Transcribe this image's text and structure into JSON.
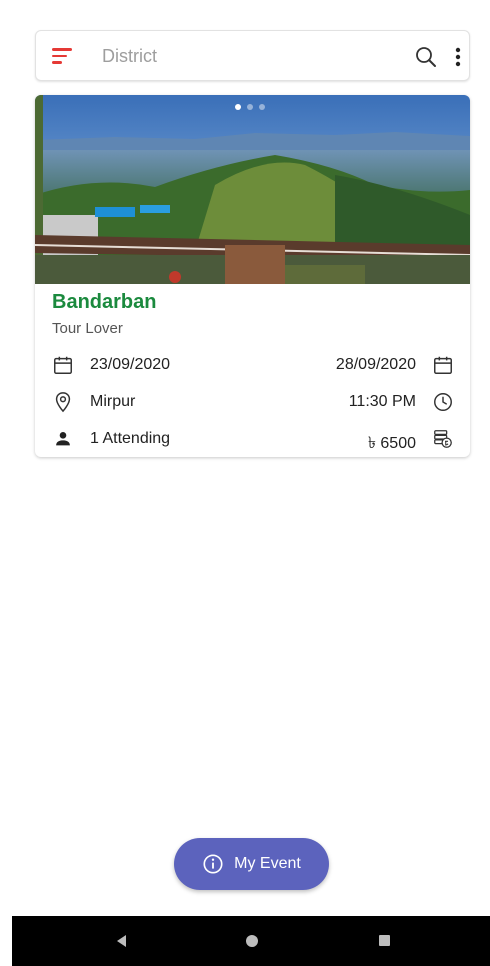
{
  "search": {
    "placeholder": "District",
    "icons": {
      "filter": "filter-list-icon",
      "search": "search-icon",
      "more": "more-vert-icon"
    }
  },
  "event_card": {
    "image": "hill-viewpoint-landscape",
    "carousel": {
      "total": 3,
      "active_index": 0
    },
    "title": "Bandarban",
    "organizer": "Tour Lover",
    "start_date": "23/09/2020",
    "end_date": "28/09/2020",
    "location": "Mirpur",
    "time": "11:30 PM",
    "attending": "1 Attending",
    "price": "৳ 6500",
    "icons": {
      "start_date": "calendar-icon",
      "end_date": "calendar-icon",
      "location": "location-pin-icon",
      "time": "clock-icon",
      "attending": "person-icon",
      "price": "money-icon"
    }
  },
  "fab": {
    "label": "My Event",
    "icon": "info-icon"
  },
  "nav": {
    "back": "back-icon",
    "home": "home-icon",
    "recent": "recent-apps-icon"
  },
  "colors": {
    "title_green": "#1b8a3e",
    "filter_red": "#e53935",
    "fab_purple": "#5c63bd",
    "nav_bg": "#000000"
  }
}
